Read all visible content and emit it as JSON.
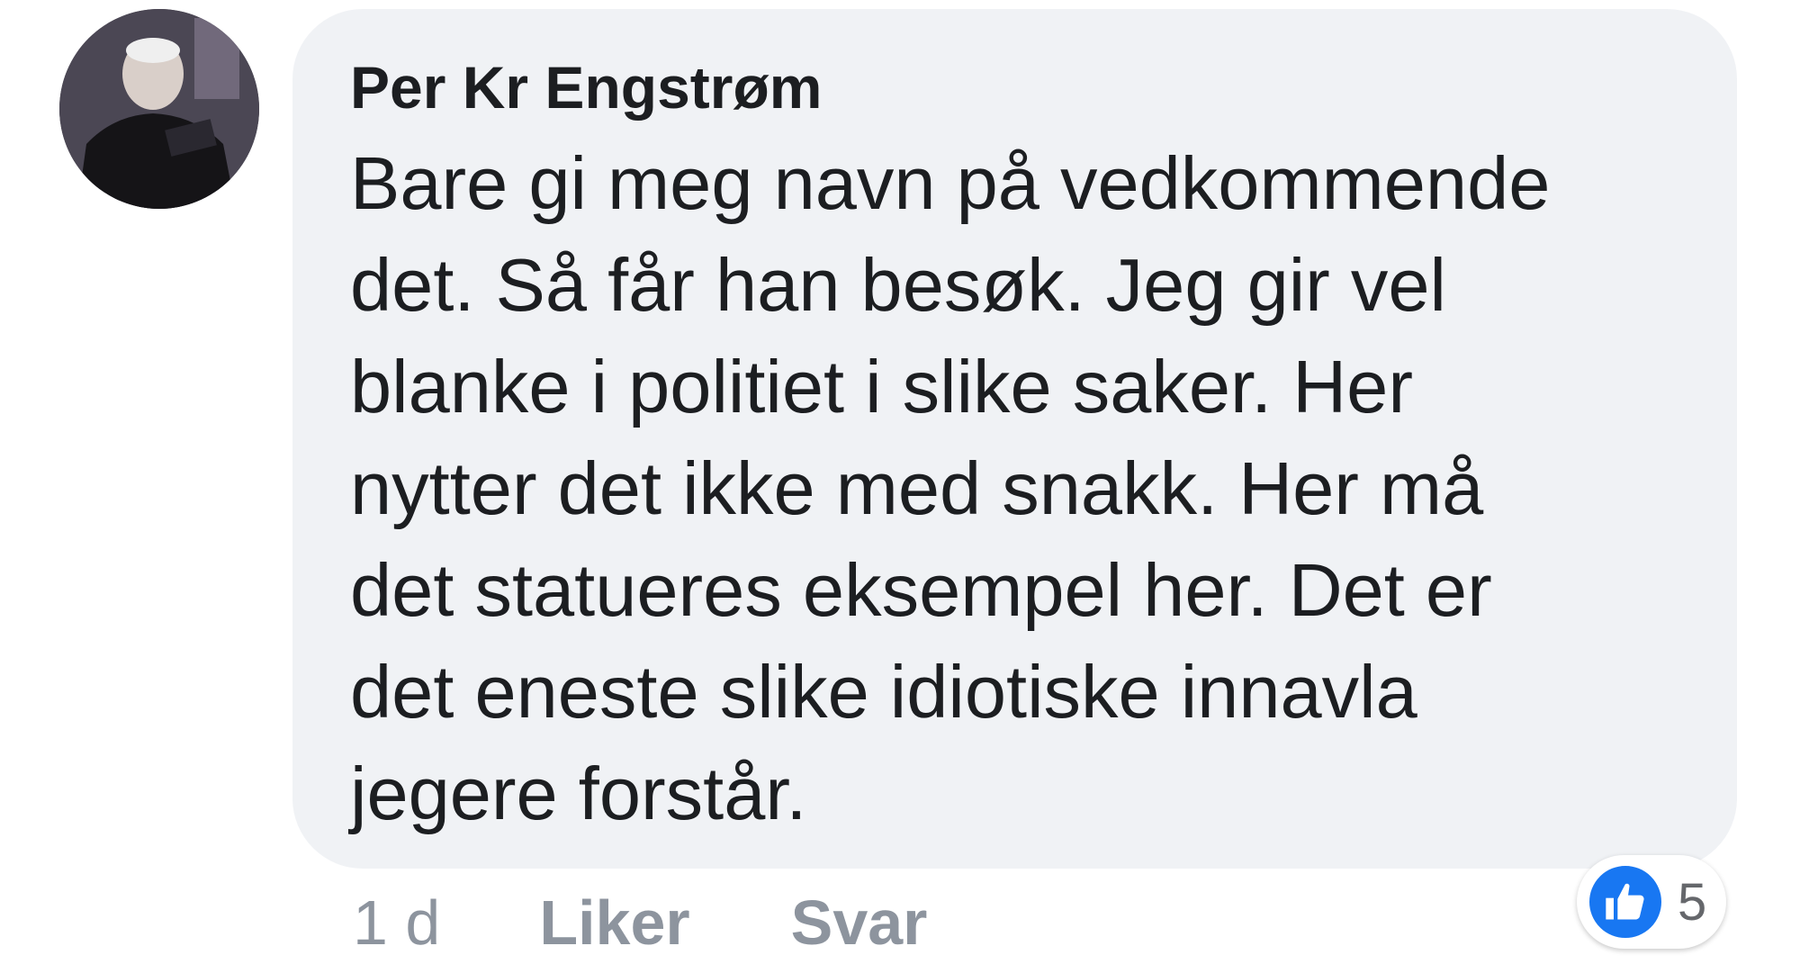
{
  "comment": {
    "author": "Per Kr Engstrøm",
    "text_lines": [
      "Bare gi meg navn på vedkommende",
      "det. Så får han besøk. Jeg gir vel",
      "blanke i politiet i slike saker. Her",
      "nytter det ikke med snakk. Her må",
      "det statueres eksempel her. Det er",
      "det eneste slike idiotiske innavla",
      "jegere forstår."
    ],
    "timestamp": "1 d",
    "like_label": "Liker",
    "reply_label": "Svar",
    "reaction_count": "5",
    "reaction_icon": "thumbs-up-icon",
    "colors": {
      "bubble": "#f0f2f5",
      "like_blue": "#1877f2",
      "text": "#1c1e21",
      "meta": "#8d949e"
    }
  }
}
